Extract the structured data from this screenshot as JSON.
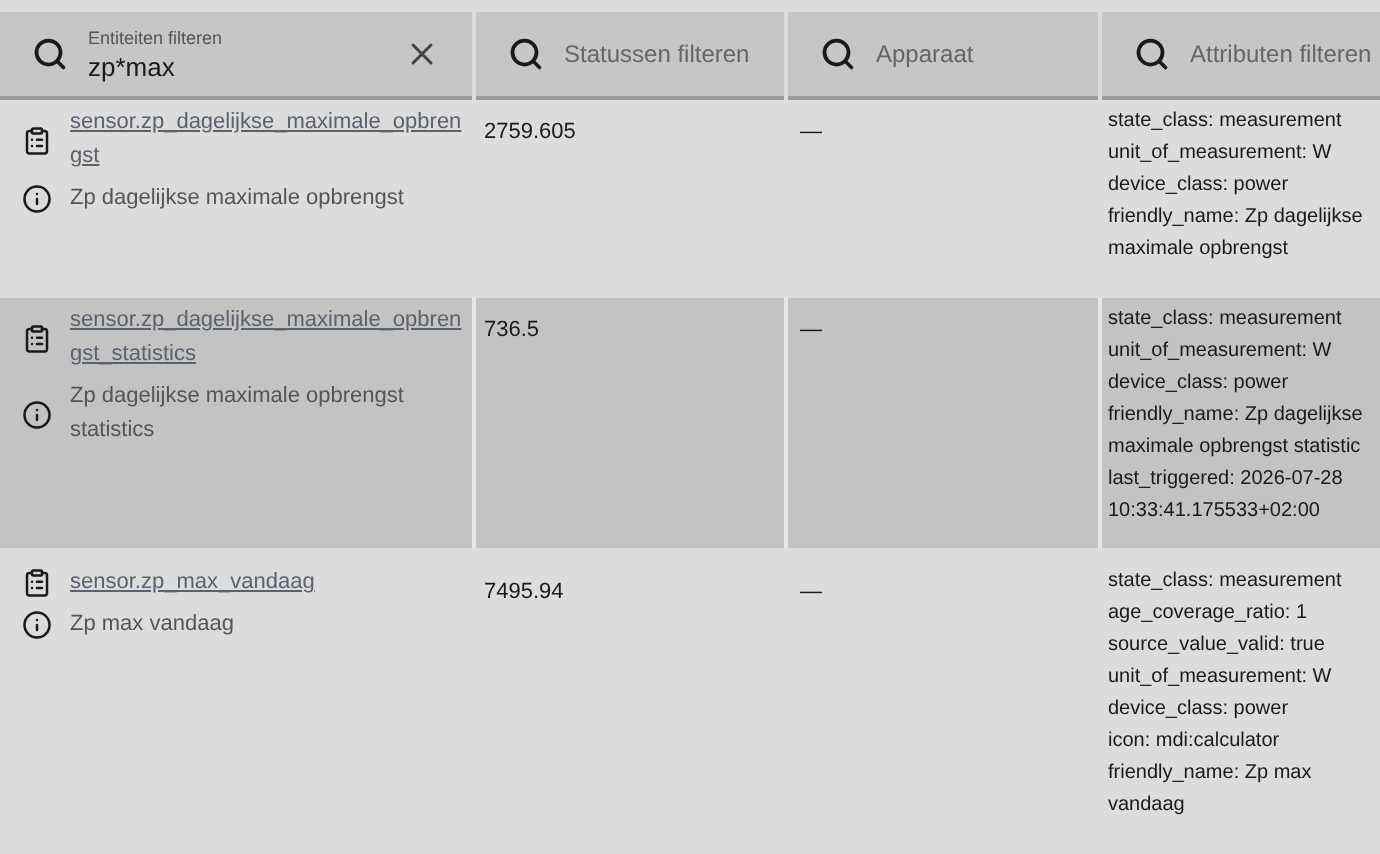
{
  "filters": [
    {
      "label": "Entiteiten filteren",
      "value": "zp*max",
      "clearable": true
    },
    {
      "placeholder": "Statussen filteren"
    },
    {
      "placeholder": "Apparaat"
    },
    {
      "placeholder": "Attributen filteren"
    }
  ],
  "rows": [
    {
      "entity_id": "sensor.zp_dagelijkse_maximale_opbrengst",
      "name": "Zp dagelijkse maximale opbrengst",
      "state": "2759.605",
      "device": "—",
      "highlighted": false,
      "attributes": [
        "state_class: measurement",
        "unit_of_measurement: W",
        "device_class: power",
        "friendly_name: Zp dagelijkse maximale opbrengst"
      ]
    },
    {
      "entity_id": "sensor.zp_dagelijkse_maximale_opbrengst_statistics",
      "name": "Zp dagelijkse maximale opbrengst statistics",
      "state": "736.5",
      "device": "—",
      "highlighted": true,
      "attributes": [
        "state_class: measurement",
        "unit_of_measurement: W",
        "device_class: power",
        "friendly_name: Zp dagelijkse maximale opbrengst statistic",
        "last_triggered: 2026-07-28 10:33:41.175533+02:00"
      ]
    },
    {
      "entity_id": "sensor.zp_max_vandaag",
      "name": "Zp max vandaag",
      "state": "7495.94",
      "device": "—",
      "highlighted": false,
      "attributes": [
        "state_class: measurement",
        "age_coverage_ratio: 1",
        "source_value_valid: true",
        "unit_of_measurement: W",
        "device_class: power",
        "icon: mdi:calculator",
        "friendly_name: Zp max vandaag"
      ]
    }
  ]
}
